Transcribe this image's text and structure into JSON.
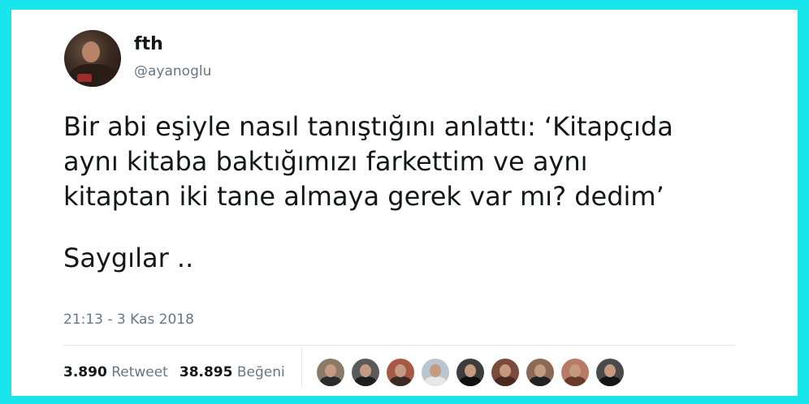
{
  "user": {
    "name": "fth",
    "handle": "@ayanoglu"
  },
  "tweet": {
    "lines": [
      "Bir abi eşiyle nasıl tanıştığını anlattı: ‘Kitapçıda",
      "aynı kitaba baktığımızı farkettim ve aynı",
      "kitaptan iki tane almaya gerek var mı? dedim’",
      "Saygılar .."
    ],
    "timestamp": "21:13 - 3 Kas 2018"
  },
  "stats": {
    "retweet_count": "3.890",
    "retweet_label": "Retweet",
    "like_count": "38.895",
    "like_label": "Beğeni"
  },
  "colors": {
    "frame": "#19e6ec",
    "text": "#14171a",
    "muted": "#657786"
  },
  "likers": [
    {
      "icon": "liker-avatar-1"
    },
    {
      "icon": "liker-avatar-2"
    },
    {
      "icon": "liker-avatar-3"
    },
    {
      "icon": "liker-avatar-4"
    },
    {
      "icon": "liker-avatar-5"
    },
    {
      "icon": "liker-avatar-6"
    },
    {
      "icon": "liker-avatar-7"
    },
    {
      "icon": "liker-avatar-8"
    },
    {
      "icon": "liker-avatar-9"
    }
  ]
}
